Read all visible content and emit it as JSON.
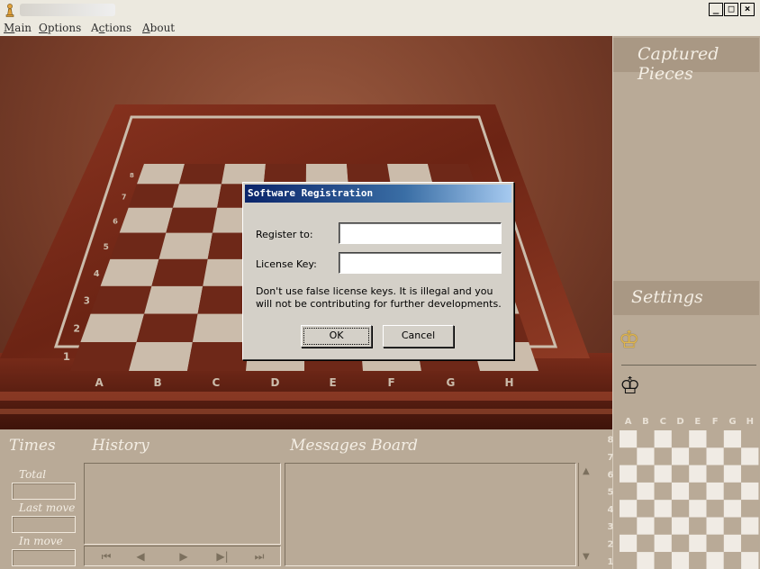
{
  "menu": {
    "items": [
      {
        "label": "Main",
        "accel": "M"
      },
      {
        "label": "Options",
        "accel": "O"
      },
      {
        "label": "Actions",
        "accel": "c"
      },
      {
        "label": "About",
        "accel": "A"
      }
    ]
  },
  "window_buttons": {
    "minimize": "_",
    "maximize": "□",
    "close": "×"
  },
  "board": {
    "rank_labels": [
      "1",
      "2",
      "3",
      "4",
      "5",
      "6",
      "7",
      "8"
    ],
    "file_labels": [
      "A",
      "B",
      "C",
      "D",
      "E",
      "F",
      "G",
      "H"
    ]
  },
  "right_panel": {
    "captured_title": "Captured Pieces",
    "settings_title": "Settings",
    "white_king_glyph": "♔",
    "black_king_glyph": "♔"
  },
  "mini_board": {
    "file_labels": [
      "A",
      "B",
      "C",
      "D",
      "E",
      "F",
      "G",
      "H"
    ],
    "rank_labels": [
      "8",
      "7",
      "6",
      "5",
      "4",
      "3",
      "2",
      "1"
    ]
  },
  "bottom": {
    "times_title": "Times",
    "history_title": "History",
    "messages_title": "Messages Board",
    "time_labels": [
      "Total",
      "Last move",
      "In move"
    ],
    "nav_glyphs": [
      "⏮",
      "◀",
      "▶",
      "▶|",
      "⏭"
    ],
    "scroll_up": "▲",
    "scroll_down": "▼"
  },
  "dialog": {
    "title": "Software Registration",
    "register_label": "Register to:",
    "register_value": "",
    "license_label": "License Key:",
    "license_value": "",
    "note": "Don't use false license keys. It is illegal and you will not be contributing for further developments.",
    "ok_label": "OK",
    "cancel_label": "Cancel"
  },
  "colors": {
    "panel": "#b9aa97",
    "panel_header": "#a99884",
    "board_light": "#cbbcab",
    "board_dark": "#6e2818",
    "frame_wood": "#7a2e1c",
    "dialog_title": "#0a246a"
  }
}
